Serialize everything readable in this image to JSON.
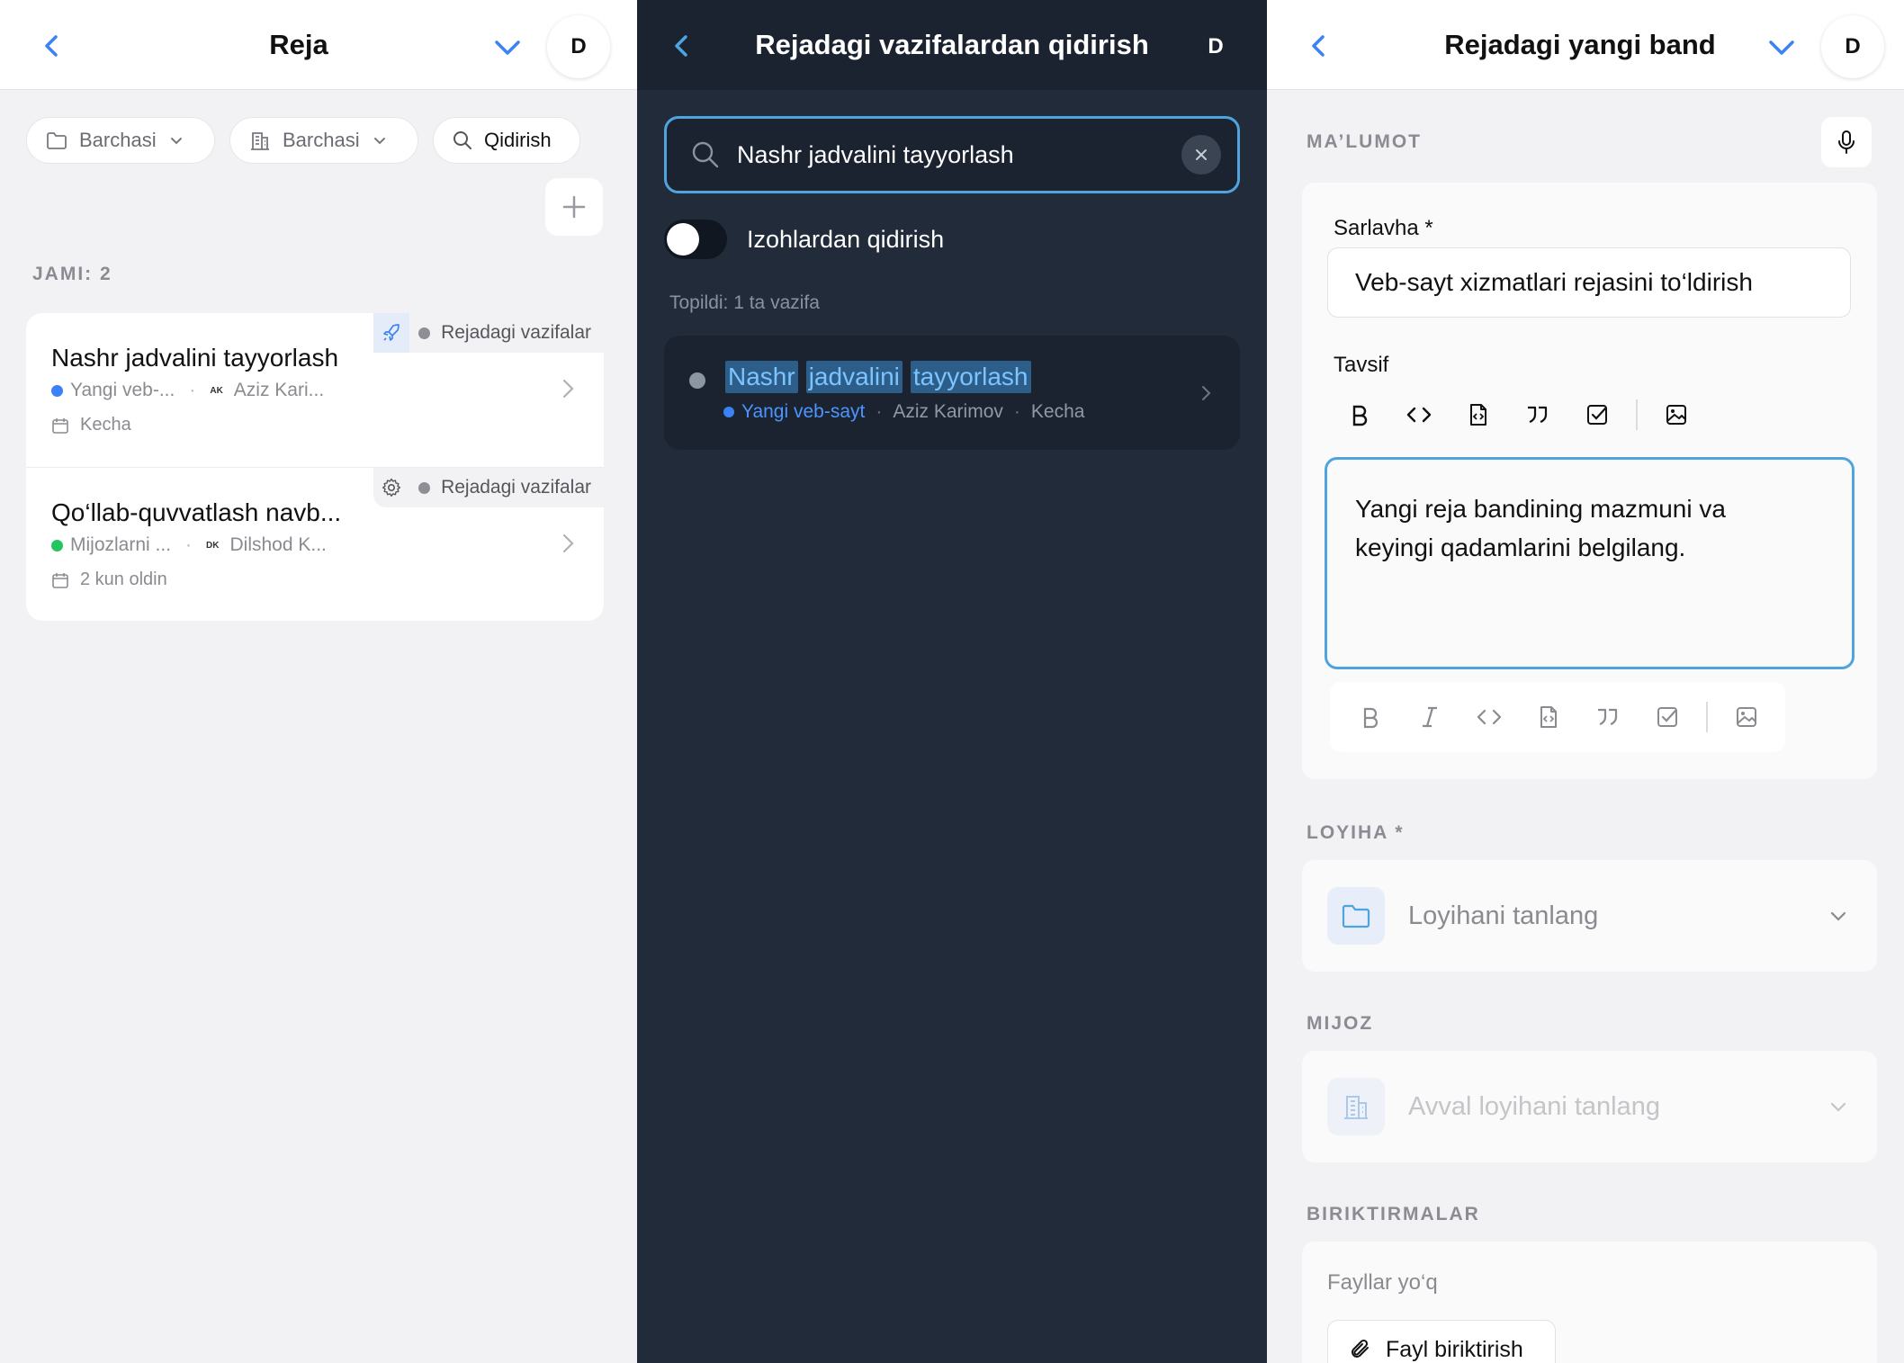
{
  "panel1": {
    "header": {
      "title": "Reja",
      "avatar": "D"
    },
    "filters": [
      {
        "label": "Barchasi",
        "icon": "folder-icon"
      },
      {
        "label": "Barchasi",
        "icon": "building-icon"
      },
      {
        "label": "Qidirish",
        "icon": "search-icon"
      }
    ],
    "total_label": "JAMI: 2",
    "tasks": [
      {
        "badge": "Rejadagi vazifalar",
        "badge_icon": "rocket-icon",
        "title": "Nashr jadvalini tayyorlash",
        "project": "Yangi veb-...",
        "project_color": "#3b82f6",
        "assignee_initials": "AK",
        "assignee": "Aziz Kari...",
        "date": "Kecha"
      },
      {
        "badge": "Rejadagi vazifalar",
        "badge_icon": "gear-icon",
        "title": "Qo‘llab-quvvatlash navb...",
        "project": "Mijozlarni ...",
        "project_color": "#22c55e",
        "assignee_initials": "DK",
        "assignee": "Dilshod K...",
        "date": "2 kun oldin"
      }
    ]
  },
  "panel2": {
    "header": {
      "title": "Rejadagi vazifalardan qidirish",
      "avatar": "D"
    },
    "search_value": "Nashr jadvalini tayyorlash",
    "toggle_label": "Izohlardan qidirish",
    "found_text": "Topildi: 1 ta vazifa",
    "result": {
      "title_words": [
        "Nashr",
        "jadvalini",
        "tayyorlash"
      ],
      "project": "Yangi veb-sayt",
      "assignee": "Aziz Karimov",
      "date": "Kecha"
    }
  },
  "panel3": {
    "header": {
      "title": "Rejadagi yangi band",
      "avatar": "D"
    },
    "info_label": "MA’LUMOT",
    "title_label": "Sarlavha *",
    "title_value": "Veb-sayt xizmatlari rejasini to‘ldirish",
    "desc_label": "Tavsif",
    "desc_line1": "Yangi reja bandining mazmuni va",
    "desc_line2": "keyingi qadamlarini belgilang.",
    "project_label": "LOYIHA *",
    "project_placeholder": "Loyihani tanlang",
    "client_label": "MIJOZ",
    "client_placeholder": "Avval loyihani tanlang",
    "attach_label": "BIRIKTIRMALAR",
    "no_files": "Fayllar yo‘q",
    "attach_button": "Fayl biriktirish"
  },
  "colors": {
    "accent": "#3b82f6",
    "focus_border": "#4fa4de",
    "dark_bg": "#222b3a",
    "highlight_bg": "#2d5e8a",
    "highlight_text": "#7cc4ff",
    "green": "#22c55e"
  }
}
